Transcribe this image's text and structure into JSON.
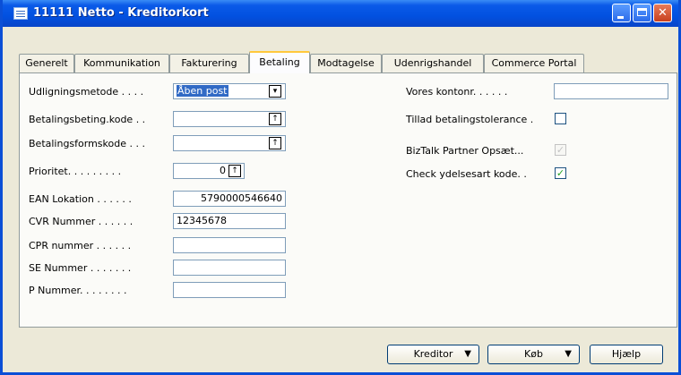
{
  "window": {
    "title": "11111 Netto - Kreditorkort"
  },
  "tabs": [
    "Generelt",
    "Kommunikation",
    "Fakturering",
    "Betaling",
    "Modtagelse",
    "Udenrigshandel",
    "Commerce Portal"
  ],
  "active_tab": "Betaling",
  "left_fields": [
    {
      "label": "Udligningsmetode . . . .",
      "value": "Åben post",
      "control": "dropdown"
    },
    {
      "label": "Betalingsbeting.kode . .",
      "value": "",
      "control": "lookup"
    },
    {
      "label": "Betalingsformskode . . .",
      "value": "",
      "control": "lookup"
    },
    {
      "label": "Prioritet. . . . . . . . .",
      "value": "0",
      "control": "lookup"
    },
    {
      "label": "EAN Lokation . . . . . .",
      "value": "5790000546640"
    },
    {
      "label": "CVR Nummer . . . . . .",
      "value": "12345678"
    },
    {
      "label": "CPR nummer . . . . . .",
      "value": ""
    },
    {
      "label": "SE Nummer . . . . . . .",
      "value": ""
    },
    {
      "label": "P Nummer. . . . . . . .",
      "value": ""
    }
  ],
  "right_fields": [
    {
      "label": "Vores kontonr. . . . . .",
      "value": ""
    },
    {
      "label": "Tillad betalingstolerance .",
      "checked": false,
      "enabled": true
    },
    {
      "label": "BizTalk Partner Opsæt...",
      "checked": true,
      "enabled": false
    },
    {
      "label": "Check ydelsesart kode. .",
      "checked": true,
      "enabled": true
    }
  ],
  "buttons": {
    "kreditor": "Kreditor",
    "kob": "Køb",
    "hjaelp": "Hjælp"
  },
  "icons": {
    "dropdown": "▾",
    "lookup": "↑",
    "check": "✓"
  }
}
